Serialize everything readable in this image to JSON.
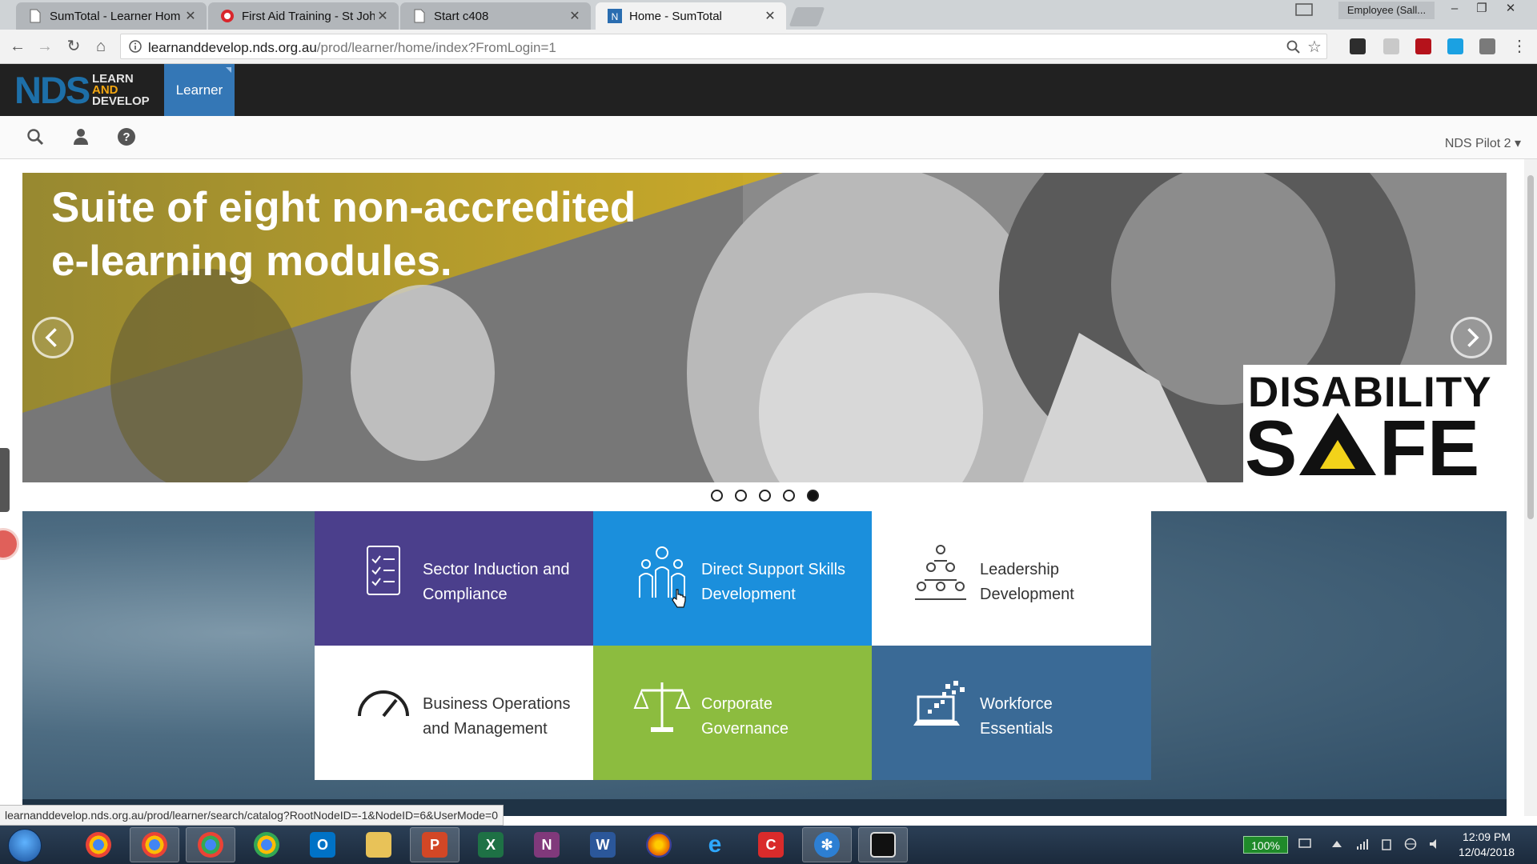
{
  "browser": {
    "tabs": [
      {
        "title": "SumTotal - Learner Hom",
        "active": false,
        "favicon": "doc-icon"
      },
      {
        "title": "First Aid Training - St Joh",
        "active": false,
        "favicon": "st-john-icon"
      },
      {
        "title": "Start c408",
        "active": false,
        "favicon": "doc-icon"
      },
      {
        "title": "Home - SumTotal",
        "active": true,
        "favicon": "sumtotal-icon"
      }
    ],
    "profile_label": "Employee (Sall...",
    "url_host": "learnanddevelop.nds.org.au",
    "url_path": "/prod/learner/home/index?FromLogin=1"
  },
  "site": {
    "logo": {
      "nds": "NDS",
      "learn": "LEARN",
      "and": "AND",
      "develop": "DEVELOP"
    },
    "nav_tab": "Learner",
    "org_switcher": "NDS Pilot 2"
  },
  "hero": {
    "headline_line1": "Suite of eight non-accredited",
    "headline_line2": "e-learning modules.",
    "brand_line1": "DISABILITY",
    "brand_line2": "SAFE",
    "slides_count": 5,
    "active_slide": 5
  },
  "categories": [
    {
      "label_line1": "Sector Induction and",
      "label_line2": "Compliance",
      "color": "#4b3f8c",
      "icon": "checklist-icon"
    },
    {
      "label_line1": "Direct Support Skills",
      "label_line2": "Development",
      "color": "#1b8fdc",
      "icon": "support-people-icon"
    },
    {
      "label_line1": "Leadership",
      "label_line2": "Development",
      "color": "#ffffff",
      "icon": "leadership-pyramid-icon"
    },
    {
      "label_line1": "Business Operations",
      "label_line2": "and Management",
      "color": "#ffffff",
      "icon": "gauge-icon"
    },
    {
      "label_line1": "Corporate",
      "label_line2": "Governance",
      "color": "#8cbc3f",
      "icon": "scales-icon"
    },
    {
      "label_line1": "Workforce",
      "label_line2": "Essentials",
      "color": "#3a6a96",
      "icon": "laptop-pixels-icon"
    }
  ],
  "status_bar": "learnanddevelop.nds.org.au/prod/learner/search/catalog?RootNodeID=-1&NodeID=6&UserMode=0",
  "taskbar": {
    "battery": "100%",
    "time": "12:09 PM",
    "date": "12/04/2018",
    "apps": [
      "chrome",
      "chrome",
      "chrome",
      "chrome",
      "outlook",
      "file-explorer",
      "powerpoint",
      "excel",
      "onenote",
      "word",
      "firefox",
      "internet-explorer",
      "ccleaner",
      "settings-app",
      "screen-capture"
    ]
  }
}
